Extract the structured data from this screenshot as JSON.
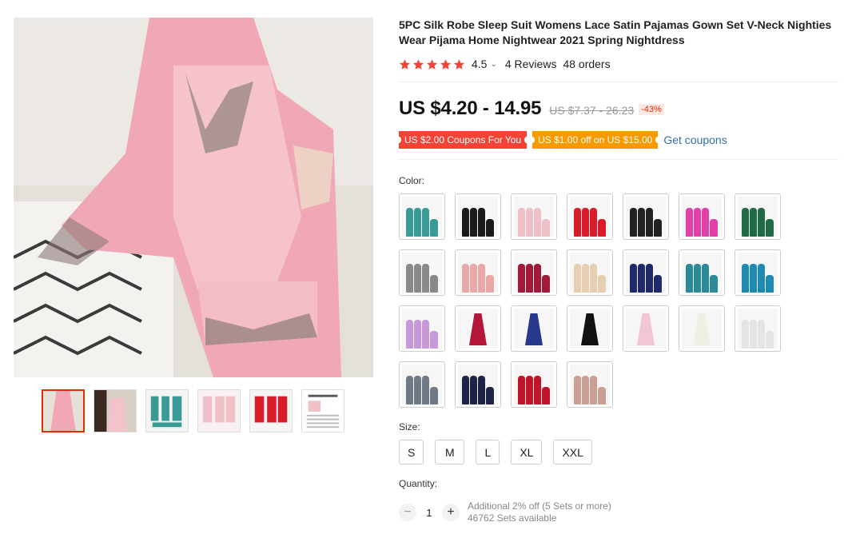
{
  "product": {
    "title": "5PC Silk Robe Sleep Suit Womens Lace Satin Pajamas Gown Set V-Neck Nighties Wear Pijama Home Nightwear 2021 Spring Nightdress",
    "rating": "4.5",
    "rating_stars": 5,
    "reviews": "4 Reviews",
    "orders": "48 orders"
  },
  "price": {
    "current": "US $4.20 - 14.95",
    "original": "US $7.37 - 26.23",
    "discount": "-43%"
  },
  "coupons": {
    "coupon1": "US $2.00 Coupons For You",
    "coupon2": "US $1.00 off on US $15.00",
    "get_coupons": "Get coupons"
  },
  "color": {
    "label": "Color:",
    "swatches": [
      {
        "name": "teal-set",
        "colors": [
          "#3a9a96",
          "#3a9a96",
          "#3a9a96",
          "#3a9a96"
        ]
      },
      {
        "name": "black-set",
        "colors": [
          "#1a1a1a",
          "#1a1a1a",
          "#1a1a1a",
          "#1a1a1a"
        ]
      },
      {
        "name": "pink-set",
        "colors": [
          "#f0c0c8",
          "#f0c0c8",
          "#f0c0c8",
          "#f0c0c8"
        ]
      },
      {
        "name": "red-set",
        "colors": [
          "#d91c2a",
          "#d91c2a",
          "#d91c2a",
          "#d91c2a"
        ]
      },
      {
        "name": "black-set-2",
        "colors": [
          "#222",
          "#222",
          "#222",
          "#222"
        ]
      },
      {
        "name": "magenta-set",
        "colors": [
          "#e040a8",
          "#e040a8",
          "#e040a8",
          "#e040a8"
        ]
      },
      {
        "name": "green-set",
        "colors": [
          "#1f6b45",
          "#1f6b45",
          "#1f6b45",
          "#1f6b45"
        ]
      },
      {
        "name": "grey-set",
        "colors": [
          "#8a8a8a",
          "#8a8a8a",
          "#8a8a8a",
          "#8a8a8a"
        ]
      },
      {
        "name": "pink-lace-set",
        "colors": [
          "#e8a8a8",
          "#e8a8a8",
          "#e8a8a8",
          "#e8a8a8"
        ]
      },
      {
        "name": "wine-set",
        "colors": [
          "#a01a3a",
          "#a01a3a",
          "#a01a3a",
          "#a01a3a"
        ]
      },
      {
        "name": "champagne-set",
        "colors": [
          "#e5cfb0",
          "#e5cfb0",
          "#e5cfb0",
          "#e5cfb0"
        ]
      },
      {
        "name": "navy-set",
        "colors": [
          "#1e2a6a",
          "#1e2a6a",
          "#1e2a6a",
          "#1e2a6a"
        ]
      },
      {
        "name": "teal-set-2",
        "colors": [
          "#2a8a98",
          "#2a8a98",
          "#2a8a98",
          "#2a8a98"
        ]
      },
      {
        "name": "blue-set",
        "colors": [
          "#1e8ab0",
          "#1e8ab0",
          "#1e8ab0",
          "#1e8ab0"
        ]
      },
      {
        "name": "lilac-set",
        "colors": [
          "#c898d8",
          "#c898d8",
          "#c898d8",
          "#c898d8"
        ]
      },
      {
        "name": "wine-dress",
        "colors": [
          "#b4163a"
        ],
        "dress": true
      },
      {
        "name": "navy-dress",
        "colors": [
          "#28388a"
        ],
        "dress": true
      },
      {
        "name": "black-dress",
        "colors": [
          "#111"
        ],
        "dress": true
      },
      {
        "name": "pink-dress",
        "colors": [
          "#f2c6d2"
        ],
        "dress": true
      },
      {
        "name": "white-dress",
        "colors": [
          "#f0efe4"
        ],
        "dress": true
      },
      {
        "name": "white-set",
        "colors": [
          "#e4e4e4",
          "#e4e4e4",
          "#e4e4e4",
          "#e4e4e4"
        ]
      },
      {
        "name": "grey-robe-set",
        "colors": [
          "#707a86",
          "#707a86",
          "#707a86",
          "#707a86"
        ]
      },
      {
        "name": "navy-robe-set",
        "colors": [
          "#1e2448",
          "#1e2448",
          "#1e2448",
          "#1e2448"
        ]
      },
      {
        "name": "red-robe-set",
        "colors": [
          "#c0142a",
          "#c0142a",
          "#c0142a",
          "#c0142a"
        ]
      },
      {
        "name": "nude-robe-set",
        "colors": [
          "#caa094",
          "#caa094",
          "#caa094",
          "#caa094"
        ]
      }
    ]
  },
  "size": {
    "label": "Size:",
    "options": [
      "S",
      "M",
      "L",
      "XL",
      "XXL"
    ]
  },
  "quantity": {
    "label": "Quantity:",
    "minus": "−",
    "value": "1",
    "plus": "+",
    "additional": "Additional 2% off (5 Sets or more)",
    "available": "46762 Sets available"
  },
  "colors_theme": {
    "accent_red": "#e62e04",
    "star": "#f44336",
    "link": "#2e6fab"
  }
}
